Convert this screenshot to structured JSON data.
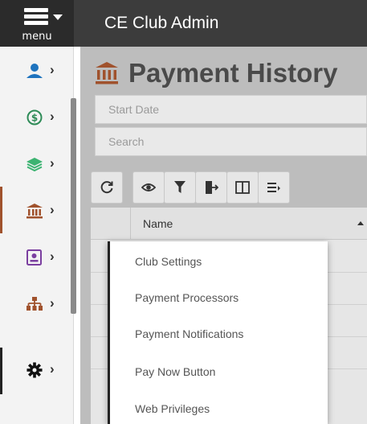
{
  "topbar": {
    "menu_label": "menu",
    "app_title": "CE Club Admin"
  },
  "sidebar": {
    "items": [
      {
        "icon": "user-icon",
        "color": "#1e73be"
      },
      {
        "icon": "dollar-circle-icon",
        "color": "#2e8b57"
      },
      {
        "icon": "layers-icon",
        "color": "#3cb371"
      },
      {
        "icon": "bank-icon",
        "color": "#a0522d",
        "active": true
      },
      {
        "icon": "id-badge-icon",
        "color": "#7b3fa0"
      },
      {
        "icon": "org-chart-icon",
        "color": "#a0522d"
      },
      {
        "icon": "gear-icon",
        "color": "#111111",
        "active": true
      }
    ]
  },
  "page": {
    "title": "Payment History",
    "title_icon": "bank-icon",
    "start_date_placeholder": "Start Date",
    "search_placeholder": "Search"
  },
  "toolbar": {
    "buttons": [
      "refresh-icon",
      "eye-icon",
      "filter-icon",
      "export-icon",
      "columns-icon",
      "list-icon"
    ]
  },
  "table": {
    "columns": [
      "Name"
    ]
  },
  "dropdown": {
    "items": [
      "Club Settings",
      "Payment Processors",
      "Payment Notifications",
      "Pay Now Button",
      "Web Privileges"
    ]
  },
  "colors": {
    "topbar": "#3c3c3c",
    "accent_bank": "#a0522d"
  }
}
